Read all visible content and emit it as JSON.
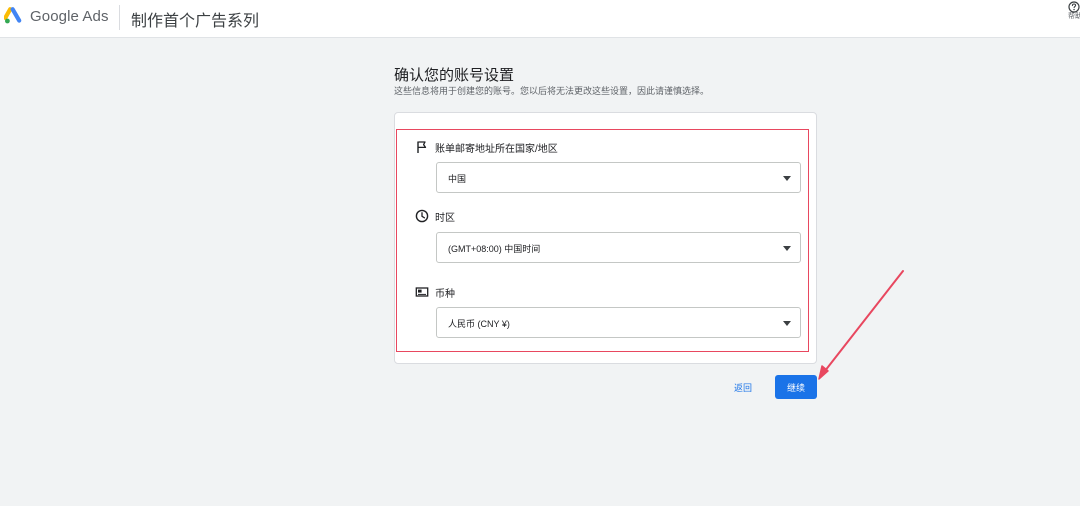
{
  "header": {
    "brand": "Google Ads",
    "page_title": "制作首个广告系列",
    "help_label": "帮助"
  },
  "main": {
    "title": "确认您的账号设置",
    "subtitle": "这些信息将用于创建您的账号。您以后将无法更改这些设置，因此请谨慎选择。"
  },
  "fields": {
    "country": {
      "label": "账单邮寄地址所在国家/地区",
      "value": "中国",
      "icon": "flag-icon"
    },
    "timezone": {
      "label": "时区",
      "value": "(GMT+08:00) 中国时间",
      "icon": "clock-icon"
    },
    "currency": {
      "label": "币种",
      "value": "人民币 (CNY ¥)",
      "icon": "currency-icon"
    }
  },
  "actions": {
    "back_label": "返回",
    "continue_label": "继续"
  },
  "colors": {
    "primary": "#1a73e8",
    "highlight": "#e8475f",
    "background": "#f1f3f4"
  }
}
